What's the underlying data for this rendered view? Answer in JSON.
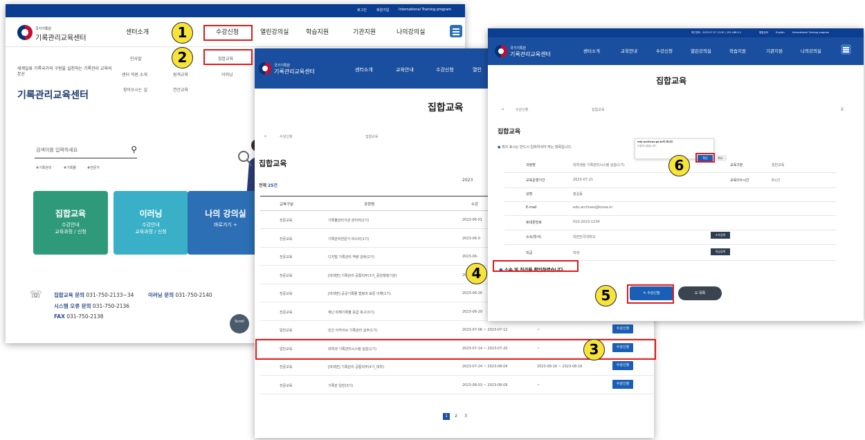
{
  "panel1": {
    "util_links": [
      "로그인",
      "회원가입",
      "International Training program"
    ],
    "logo": {
      "small": "국가기록원",
      "big": "기록관리교육센터"
    },
    "gnb": [
      "센터소개",
      "수강신청",
      "열린강의실",
      "학습지원",
      "기관지원",
      "나의강의실"
    ],
    "mega": {
      "intro": "세계일류 기록국가의 구현을 실천하는 기록관리 교육의 본산",
      "title": "기록관리교육센터",
      "col_center": [
        "인사말",
        "센터 직원 소개",
        "찾아오시는 길"
      ],
      "col_course": [
        "집합교육",
        "원격교육",
        "연간교육"
      ],
      "col_elearn": [
        "이러닝"
      ]
    },
    "search_placeholder": "검색어를 입력하세요",
    "tags": [
      "#기록관리",
      "#기록물",
      "#전문가"
    ],
    "cards": [
      {
        "title": "집합교육",
        "sub": "수강안내\n교육과정 / 신청",
        "color": "#2f9a7a"
      },
      {
        "title": "이러닝",
        "sub": "수강안내\n교육과정 / 신청",
        "color": "#3ab0c8"
      },
      {
        "title": "나의 강의실",
        "sub": "바로가기 +",
        "color": "#2d6fb5"
      }
    ],
    "contacts": {
      "group_label": "집합교육 문의",
      "group_phone": "031-750-2133~34",
      "elearn_label": "이러닝 문의",
      "elearn_phone": "031-750-2140",
      "error_label": "시스템 오류 문의",
      "error_phone": "031-750-2136",
      "fax_label": "FAX",
      "fax_phone": "031-750-2138"
    },
    "scroll_label": "Scroll"
  },
  "panel2": {
    "logo": {
      "small": "국가기록원",
      "big": "기록관리교육센터"
    },
    "nav": [
      "센터소개",
      "교육안내",
      "수강신청",
      "열린"
    ],
    "page_title": "집합교육",
    "breadcrumb": [
      "수강신청",
      "집합교육"
    ],
    "section_title": "집합교육",
    "total_label": "전체",
    "total_count": "25건",
    "year": "2023",
    "headers": [
      "교육구분",
      "과정명",
      "수강"
    ],
    "rows": [
      {
        "type": "전문교육",
        "name": "기록물관리기관 관리자(2기)",
        "date": "2023-06-01",
        "deadline": "",
        "apply": ""
      },
      {
        "type": "전문교육",
        "name": "기록관리전문가 마스터(1기)",
        "date": "2023-06-0",
        "deadline": "",
        "apply": ""
      },
      {
        "type": "전문교육",
        "name": "디지털 기록관리 역량 강화(2기)",
        "date": "2023-06-",
        "deadline": "",
        "apply": ""
      },
      {
        "type": "전문교육",
        "name": "[비대면] 기록관리 공통직무(3기_중앙행정기관)",
        "date": "2023-0",
        "deadline": "",
        "apply": ""
      },
      {
        "type": "전문교육",
        "name": "[비대면] 공공기록물 법령과 표준 이해(1기)",
        "date": "2023-06-26",
        "deadline": "",
        "apply": ""
      },
      {
        "type": "전문교육",
        "name": "재난 피해기록물 응급 복구(3기)",
        "date": "2023-06-29",
        "deadline": "",
        "apply": ""
      },
      {
        "type": "일반교육",
        "name": "민간 아카이브 기록관리 실무(1기)",
        "date": "2023-07-06 ~ 2023-07-12",
        "deadline": "~",
        "apply": "수강신청"
      },
      {
        "type": "일반교육",
        "name": "대학생 기록관리시스템 실습(1기)",
        "date": "2023-07-14 ~ 2023-07-20",
        "deadline": "~",
        "apply": "수강신청"
      },
      {
        "type": "전문교육",
        "name": "[비대면] 기록관리 공통직무(4기_대학)",
        "date": "2023-07-24 ~ 2023-08-04",
        "deadline": "2023-08-16 ~ 2023-08-16",
        "apply": "수강신청"
      },
      {
        "type": "전문교육",
        "name": "기록관 일반(3기)",
        "date": "2023-08-03 ~ 2023-08-09",
        "deadline": "~",
        "apply": "수강신청"
      }
    ],
    "pages": [
      "1",
      "2",
      "3"
    ]
  },
  "panel3": {
    "util_links": [
      "최근접속 : 2023.07.07 13:30 | 192.168.0.1",
      "통합검색",
      "English",
      "International Training program"
    ],
    "logo": {
      "small": "국가기록원",
      "big": "기록관리교육센터"
    },
    "nav": [
      "센터소개",
      "교육안내",
      "수강신청",
      "열린강의실",
      "학습지원",
      "기관지원",
      "나의강의실"
    ],
    "page_title": "집합교육",
    "breadcrumb": [
      "수강신청",
      "집합교육"
    ],
    "form_title": "집합교육",
    "required_note": "체크 표시는 반드시 입력하셔야 하는 항목입니다.",
    "fields": [
      {
        "label": "과정명",
        "value": "대학생을 기록관리시스템 실습(1기)"
      },
      {
        "label": "교육운영기간",
        "value": "2023-07-21"
      },
      {
        "label": "성명",
        "value": "홍길동"
      },
      {
        "label": "E-mail",
        "value": "edu.archives@korea.kr"
      },
      {
        "label": "휴대폰번호",
        "value": "010-2023-1234"
      },
      {
        "label": "소속(학서)",
        "value": "대한민국대학교"
      },
      {
        "label": "직급",
        "value": "학생"
      }
    ],
    "right_fields": [
      {
        "label": "교육구분",
        "value": "일반교육"
      },
      {
        "label": "교육이수시간",
        "value": "8시간"
      }
    ],
    "popup": {
      "line1": "edu.archives.go.kr의 메시지",
      "line2": "신청하시겠습니까?",
      "ok": "확인",
      "cancel": "취소"
    },
    "search_btn1": "소속검색",
    "search_btn2": "직급검색",
    "confirm_check": "소속 및 직급을 확인하였습니다.",
    "apply_btn": "수강신청",
    "list_btn": "목록"
  },
  "steps": [
    "1",
    "2",
    "3",
    "4",
    "5",
    "6"
  ],
  "colors": {
    "marker_red": "#e01818",
    "badge_yellow": "#f7e43a",
    "header_blue": "#1a4e9e",
    "util_navy": "#0b3d91"
  }
}
